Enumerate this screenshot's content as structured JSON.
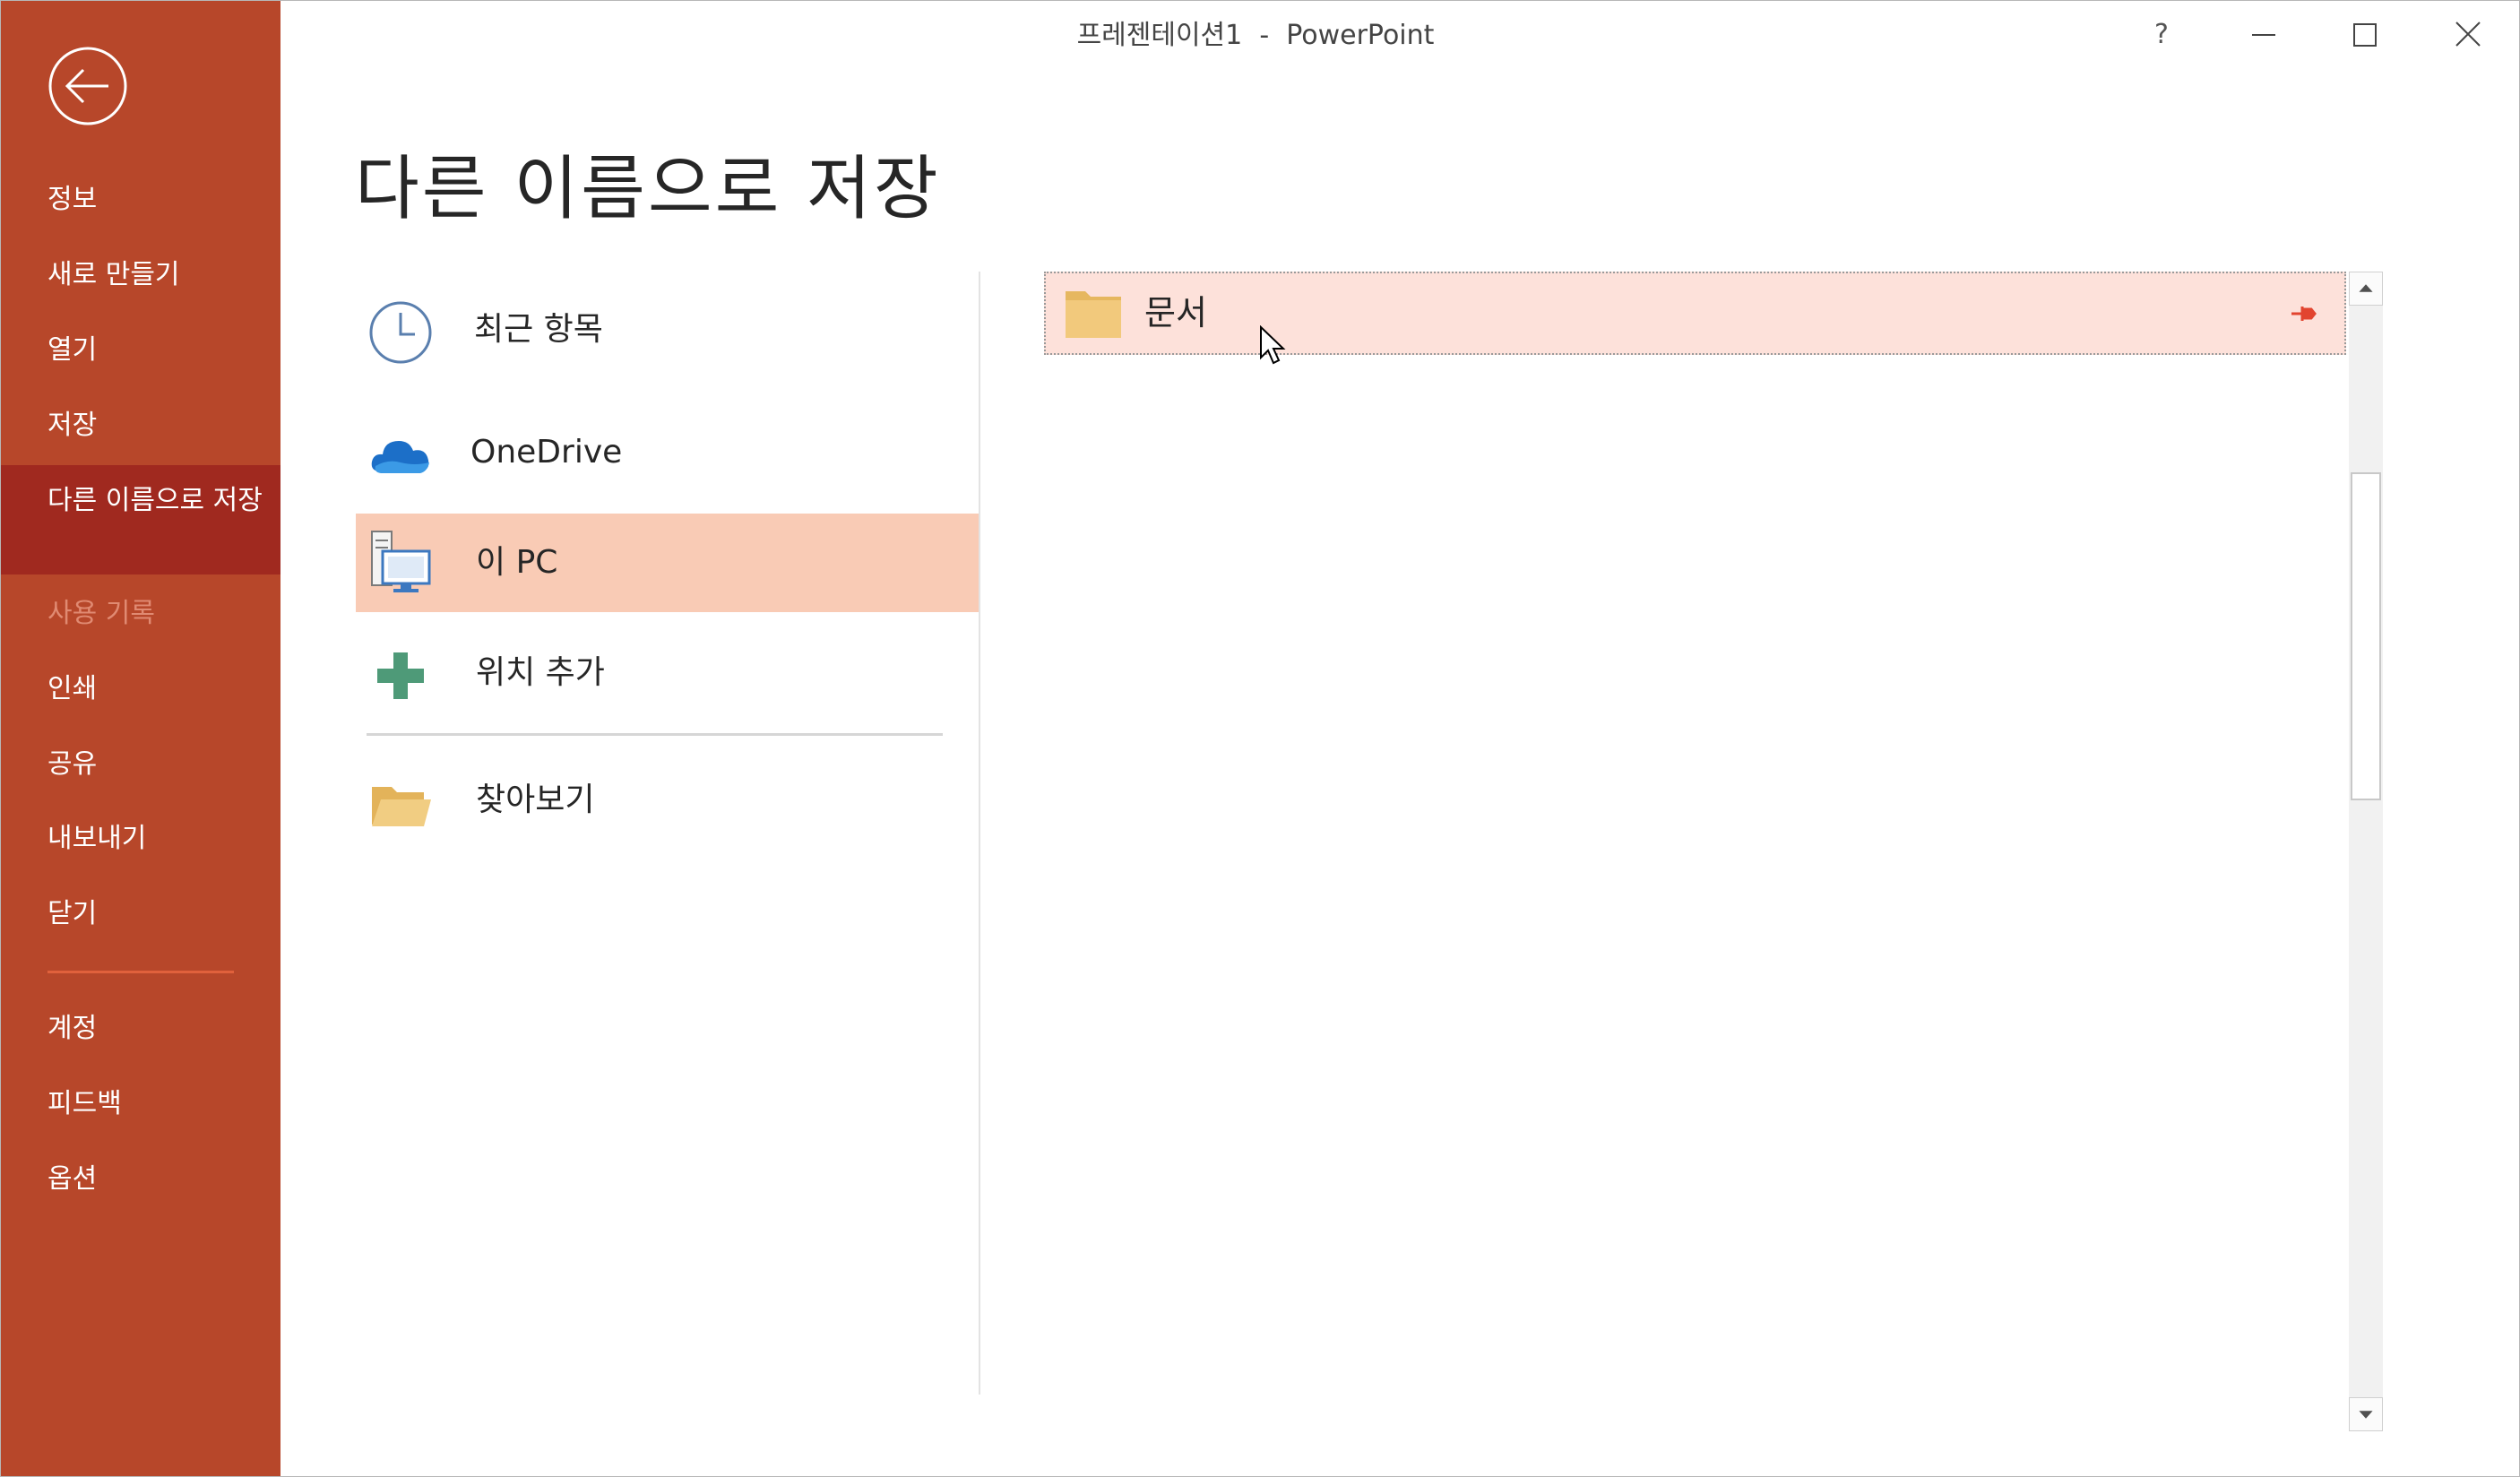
{
  "window": {
    "title": "프레젠테이션1  -  PowerPoint",
    "help_label": "?"
  },
  "sidebar": {
    "back_label": "back",
    "items": [
      {
        "label": "정보"
      },
      {
        "label": "새로 만들기"
      },
      {
        "label": "열기"
      },
      {
        "label": "저장"
      },
      {
        "label": "다른 이름으로 저장",
        "selected": true
      },
      {
        "label": "사용 기록",
        "disabled": true
      },
      {
        "label": "인쇄"
      },
      {
        "label": "공유"
      },
      {
        "label": "내보내기"
      },
      {
        "label": "닫기"
      },
      {
        "label": "계정"
      },
      {
        "label": "피드백"
      },
      {
        "label": "옵션"
      }
    ]
  },
  "main": {
    "title": "다른 이름으로 저장",
    "locations": [
      {
        "label": "최근 항목",
        "icon": "clock-icon"
      },
      {
        "label": "OneDrive",
        "icon": "cloud-icon"
      },
      {
        "label": "이 PC",
        "icon": "pc-icon",
        "selected": true
      },
      {
        "label": "위치 추가",
        "icon": "plus-icon"
      },
      {
        "label": "찾아보기",
        "icon": "folder-open-icon"
      }
    ],
    "folders": [
      {
        "label": "문서",
        "pinned": true
      }
    ]
  },
  "colors": {
    "sidebar": "#b7472a",
    "sidebar_selected": "#a0291f",
    "location_selected": "#f9cbb5",
    "folder_highlight": "#fde1da"
  }
}
